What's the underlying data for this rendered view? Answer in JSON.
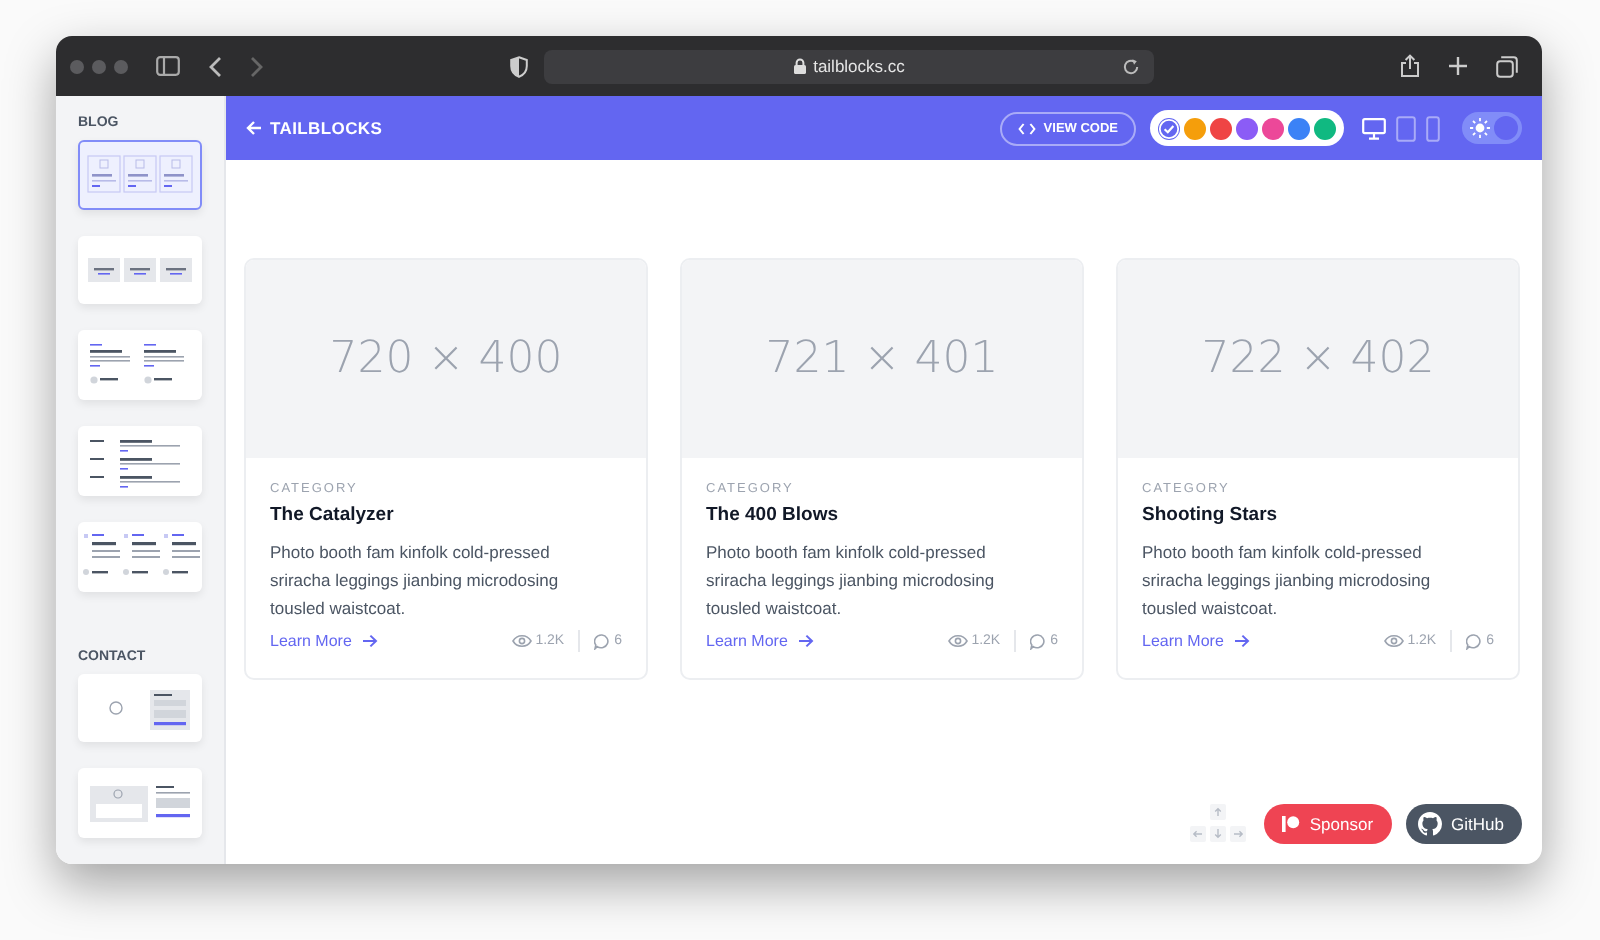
{
  "browser": {
    "url": "tailblocks.cc"
  },
  "sidebar": {
    "sections": [
      {
        "title": "BLOG",
        "items": [
          {
            "kind": "grid",
            "selected": true
          },
          {
            "kind": "cards",
            "selected": false
          },
          {
            "kind": "columns",
            "selected": false
          },
          {
            "kind": "rows",
            "selected": false
          },
          {
            "kind": "triple",
            "selected": false
          }
        ]
      },
      {
        "title": "CONTACT",
        "items": [
          {
            "kind": "map",
            "selected": false
          },
          {
            "kind": "split",
            "selected": false
          }
        ]
      }
    ]
  },
  "header": {
    "back_label": "TAILBLOCKS",
    "view_code_label": "VIEW CODE",
    "colors": [
      {
        "color": "#6366f1",
        "selected": true
      },
      {
        "color": "#f59e0b",
        "selected": false
      },
      {
        "color": "#ef4444",
        "selected": false
      },
      {
        "color": "#8b5cf6",
        "selected": false
      },
      {
        "color": "#ec4899",
        "selected": false
      },
      {
        "color": "#3b82f6",
        "selected": false
      },
      {
        "color": "#10b981",
        "selected": false
      }
    ],
    "devices": [
      {
        "kind": "desktop",
        "selected": true
      },
      {
        "kind": "tablet",
        "selected": false
      },
      {
        "kind": "phone",
        "selected": false
      }
    ],
    "dark_mode": false
  },
  "cards": [
    {
      "image_label": "720 × 400",
      "category": "CATEGORY",
      "title": "The Catalyzer",
      "text": "Photo booth fam kinfolk cold-pressed sriracha leggings jianbing microdosing tousled waistcoat.",
      "link": "Learn More",
      "views": "1.2K",
      "comments": "6"
    },
    {
      "image_label": "721 × 401",
      "category": "CATEGORY",
      "title": "The 400 Blows",
      "text": "Photo booth fam kinfolk cold-pressed sriracha leggings jianbing microdosing tousled waistcoat.",
      "link": "Learn More",
      "views": "1.2K",
      "comments": "6"
    },
    {
      "image_label": "722 × 402",
      "category": "CATEGORY",
      "title": "Shooting Stars",
      "text": "Photo booth fam kinfolk cold-pressed sriracha leggings jianbing microdosing tousled waistcoat.",
      "link": "Learn More",
      "views": "1.2K",
      "comments": "6"
    }
  ],
  "floating": {
    "sponsor_label": "Sponsor",
    "github_label": "GitHub"
  }
}
